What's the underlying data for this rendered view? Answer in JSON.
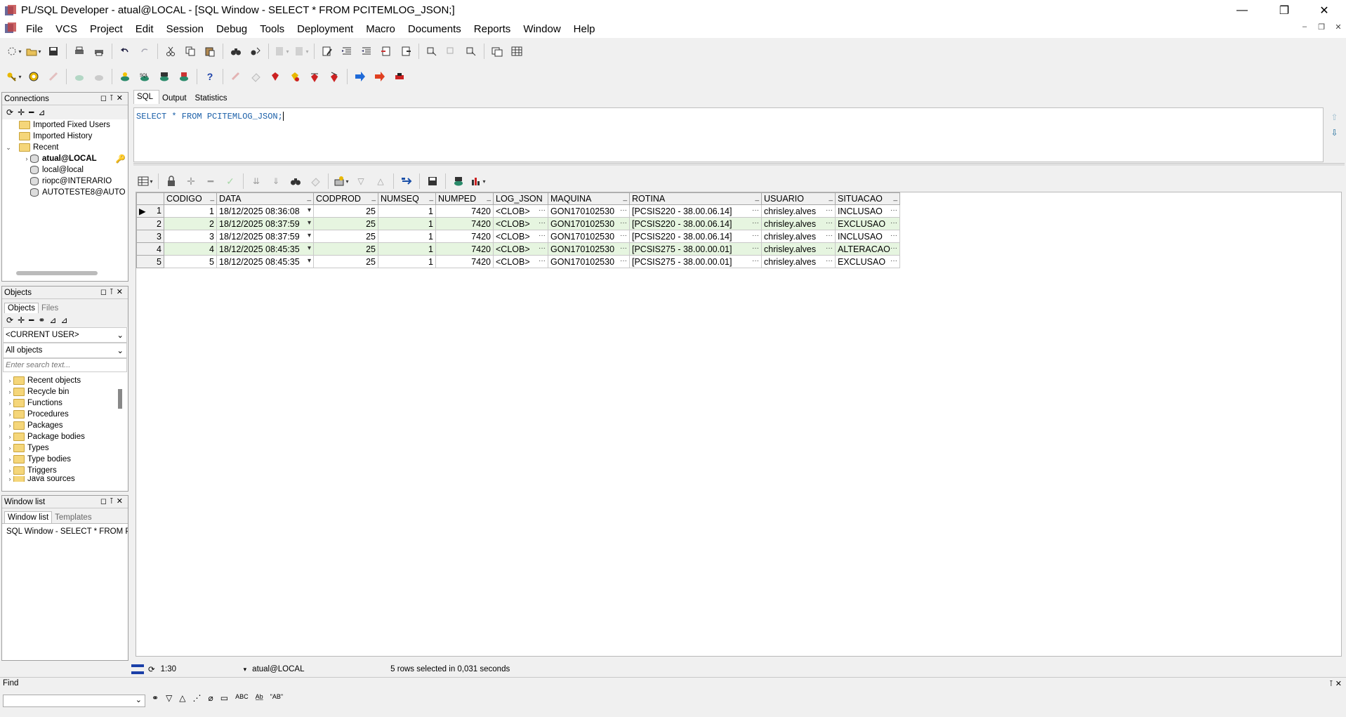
{
  "window": {
    "title": "PL/SQL Developer - atual@LOCAL - [SQL Window - SELECT * FROM PCITEMLOG_JSON;]"
  },
  "menu": [
    "File",
    "VCS",
    "Project",
    "Edit",
    "Session",
    "Debug",
    "Tools",
    "Deployment",
    "Macro",
    "Documents",
    "Reports",
    "Window",
    "Help"
  ],
  "connections": {
    "title": "Connections",
    "items": [
      {
        "label": "Imported Fixed Users",
        "kind": "folder",
        "level": 1
      },
      {
        "label": "Imported History",
        "kind": "folder",
        "level": 1
      },
      {
        "label": "Recent",
        "kind": "folder",
        "level": 0,
        "expanded": true
      },
      {
        "label": "atual@LOCAL",
        "kind": "db",
        "level": 2,
        "bold": true
      },
      {
        "label": "local@local",
        "kind": "db",
        "level": 2
      },
      {
        "label": "riopc@INTERARIO",
        "kind": "db",
        "level": 2
      },
      {
        "label": "AUTOTESTE8@AUTO",
        "kind": "db",
        "level": 2
      }
    ]
  },
  "objects": {
    "title": "Objects",
    "tabs": [
      "Objects",
      "Files"
    ],
    "user_select": "<CURRENT USER>",
    "filter_select": "All objects",
    "search_placeholder": "Enter search text...",
    "items": [
      "Recent objects",
      "Recycle bin",
      "Functions",
      "Procedures",
      "Packages",
      "Package bodies",
      "Types",
      "Type bodies",
      "Triggers",
      "Java sources"
    ]
  },
  "windowlist": {
    "title": "Window list",
    "tabs": [
      "Window list",
      "Templates"
    ],
    "item": "SQL Window - SELECT * FROM P"
  },
  "sql": {
    "tabs": [
      "SQL",
      "Output",
      "Statistics"
    ],
    "text": "SELECT * FROM PCITEMLOG_JSON;"
  },
  "grid": {
    "columns": [
      "CODIGO",
      "DATA",
      "CODPROD",
      "NUMSEQ",
      "NUMPED",
      "LOG_JSON",
      "MAQUINA",
      "ROTINA",
      "USUARIO",
      "SITUACAO"
    ],
    "rows": [
      [
        "1",
        "18/12/2025 08:36:08",
        "25",
        "1",
        "7420",
        "<CLOB>",
        "GON170102530",
        "[PCSIS220 - 38.00.06.14]",
        "chrisley.alves",
        "INCLUSAO"
      ],
      [
        "2",
        "18/12/2025 08:37:59",
        "25",
        "1",
        "7420",
        "<CLOB>",
        "GON170102530",
        "[PCSIS220 - 38.00.06.14]",
        "chrisley.alves",
        "EXCLUSAO"
      ],
      [
        "3",
        "18/12/2025 08:37:59",
        "25",
        "1",
        "7420",
        "<CLOB>",
        "GON170102530",
        "[PCSIS220 - 38.00.06.14]",
        "chrisley.alves",
        "INCLUSAO"
      ],
      [
        "4",
        "18/12/2025 08:45:35",
        "25",
        "1",
        "7420",
        "<CLOB>",
        "GON170102530",
        "[PCSIS275 - 38.00.00.01]",
        "chrisley.alves",
        "ALTERACAO"
      ],
      [
        "5",
        "18/12/2025 08:45:35",
        "25",
        "1",
        "7420",
        "<CLOB>",
        "GON170102530",
        "[PCSIS275 - 38.00.00.01]",
        "chrisley.alves",
        "EXCLUSAO"
      ]
    ]
  },
  "status": {
    "position": "1:30",
    "connection": "atual@LOCAL",
    "message": "5 rows selected in 0,031 seconds"
  },
  "find": {
    "label": "Find"
  },
  "colors": {
    "even_row": "#e6f5e0",
    "sql_text": "#1a5fa8"
  }
}
